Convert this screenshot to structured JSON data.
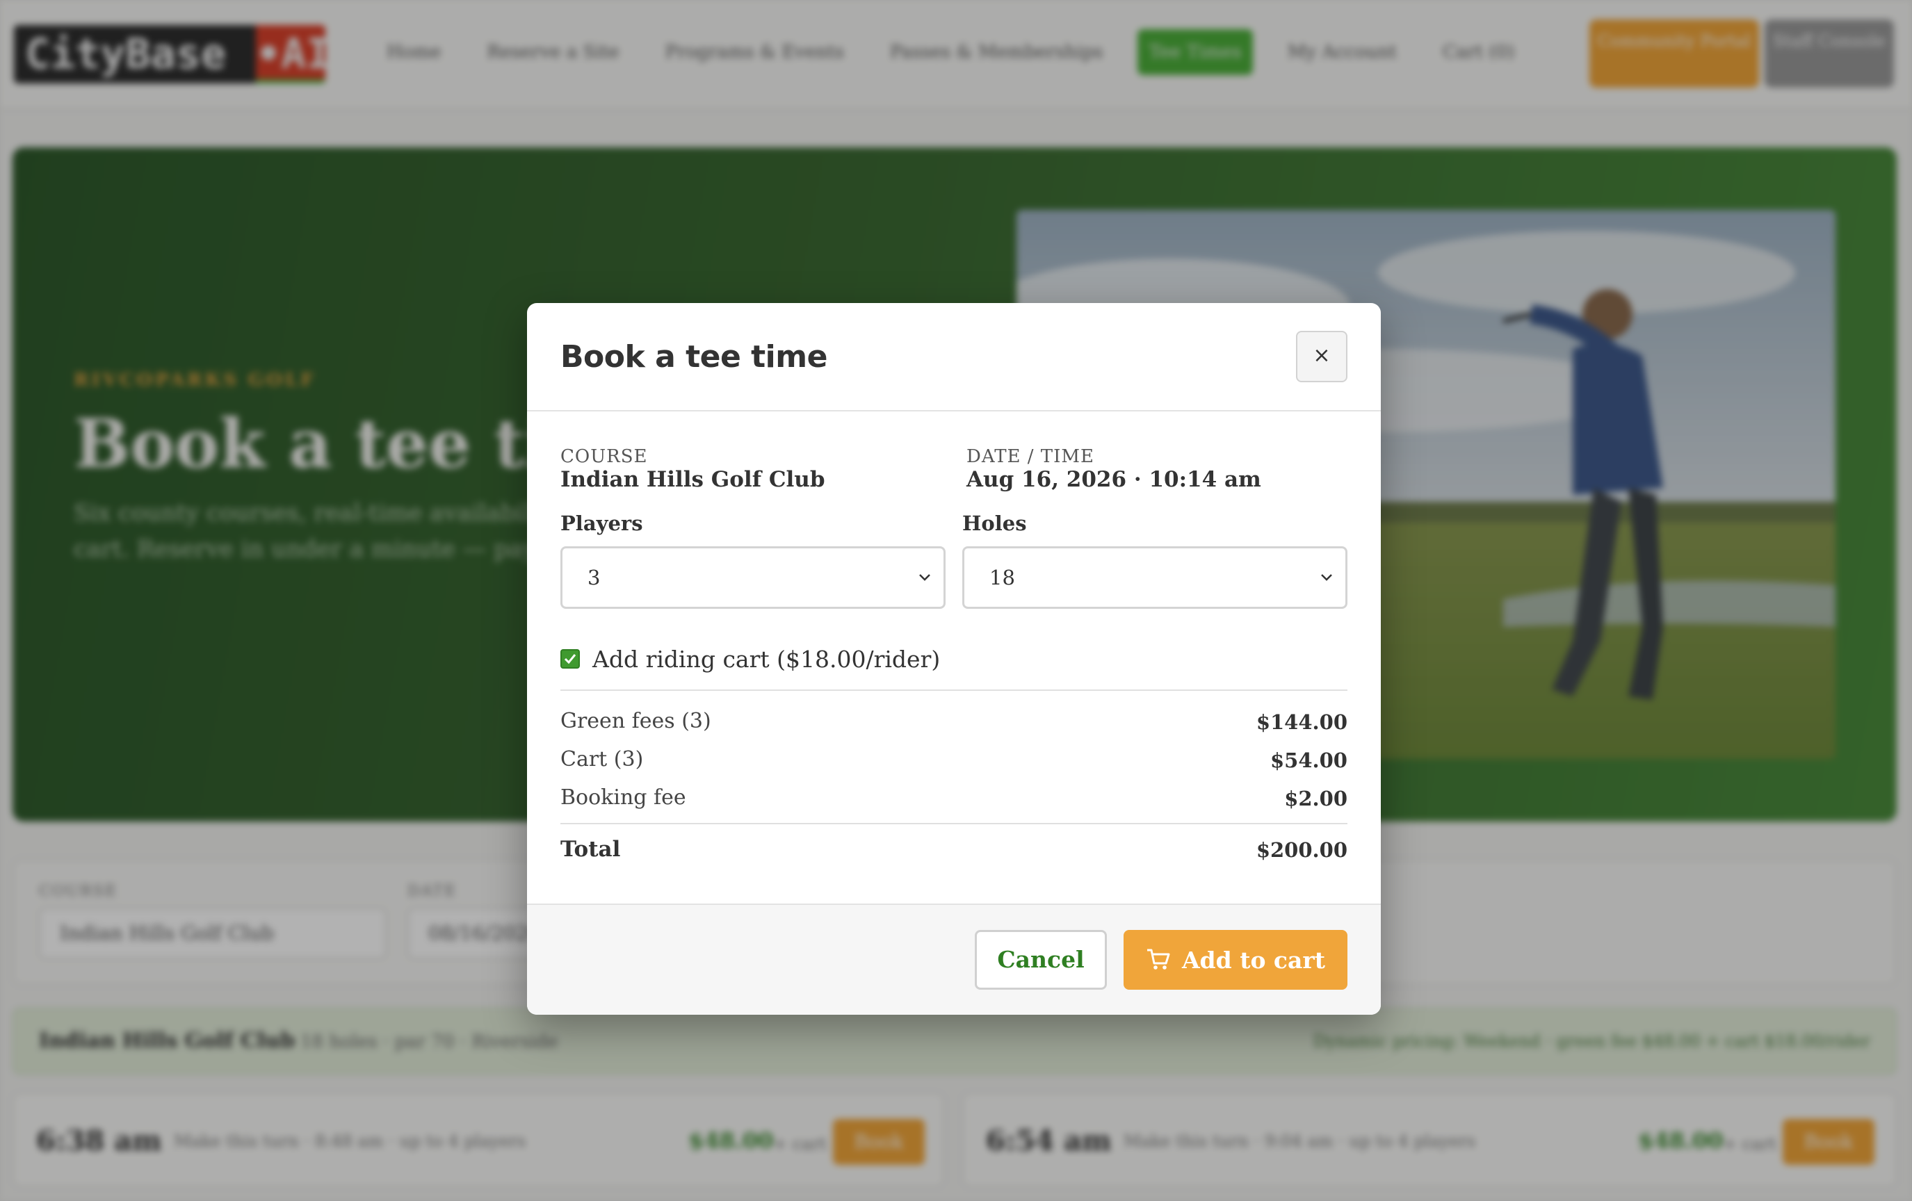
{
  "header": {
    "logo_main": "CityBase",
    "logo_ai": "•AI",
    "nav": [
      {
        "label": "Home"
      },
      {
        "label": "Reserve a Site"
      },
      {
        "label": "Programs & Events"
      },
      {
        "label": "Passes & Memberships"
      },
      {
        "label": "Tee Times"
      },
      {
        "label": "My Account"
      },
      {
        "label": "Cart (0)"
      }
    ],
    "active_nav": "Tee Times",
    "btn_community": "Community Portal",
    "btn_staff": "Staff Console"
  },
  "hero": {
    "eyebrow": "RIVCOPARKS GOLF",
    "title": "Book a tee time",
    "subtitle": "Six county courses, real-time availability, cart. Reserve in under a minute — pay"
  },
  "filters": {
    "course_label": "COURSE",
    "course_value": "Indian Hills Golf Club",
    "date_label": "DATE",
    "date_value": "08/16/2026"
  },
  "course_strip": {
    "name": "Indian Hills Golf Club",
    "meta": "18 holes · par 70 · Riverside",
    "pricing": "Dynamic pricing: Weekend · green fee $48.00 + cart $18.00/rider"
  },
  "slots": [
    {
      "time": "6:38 am",
      "meta": "Make this turn · 8:48 am · up to 4 players",
      "price": "$48.00",
      "price_note": "+ cart",
      "book": "Book"
    },
    {
      "time": "6:54 am",
      "meta": "Make this turn · 9:04 am · up to 4 players",
      "price": "$48.00",
      "price_note": "+ cart",
      "book": "Book"
    }
  ],
  "modal": {
    "title": "Book a tee time",
    "close": "×",
    "course_label": "COURSE",
    "course_value": "Indian Hills Golf Club",
    "datetime_label": "DATE / TIME",
    "datetime_value": "Aug 16, 2026 · 10:14 am",
    "players_label": "Players",
    "players_value": "3",
    "holes_label": "Holes",
    "holes_value": "18",
    "cart_checked": true,
    "cart_label": "Add riding cart ($18.00/rider)",
    "lines": [
      {
        "label": "Green fees (3)",
        "amount": "$144.00"
      },
      {
        "label": "Cart (3)",
        "amount": "$54.00"
      },
      {
        "label": "Booking fee",
        "amount": "$2.00"
      }
    ],
    "total_label": "Total",
    "total_amount": "$200.00",
    "cancel_label": "Cancel",
    "add_label": "Add to cart"
  },
  "colors": {
    "brand_green": "#3f9a2f",
    "accent_orange": "#f0a53a",
    "hero_green": "#3c6a33"
  }
}
